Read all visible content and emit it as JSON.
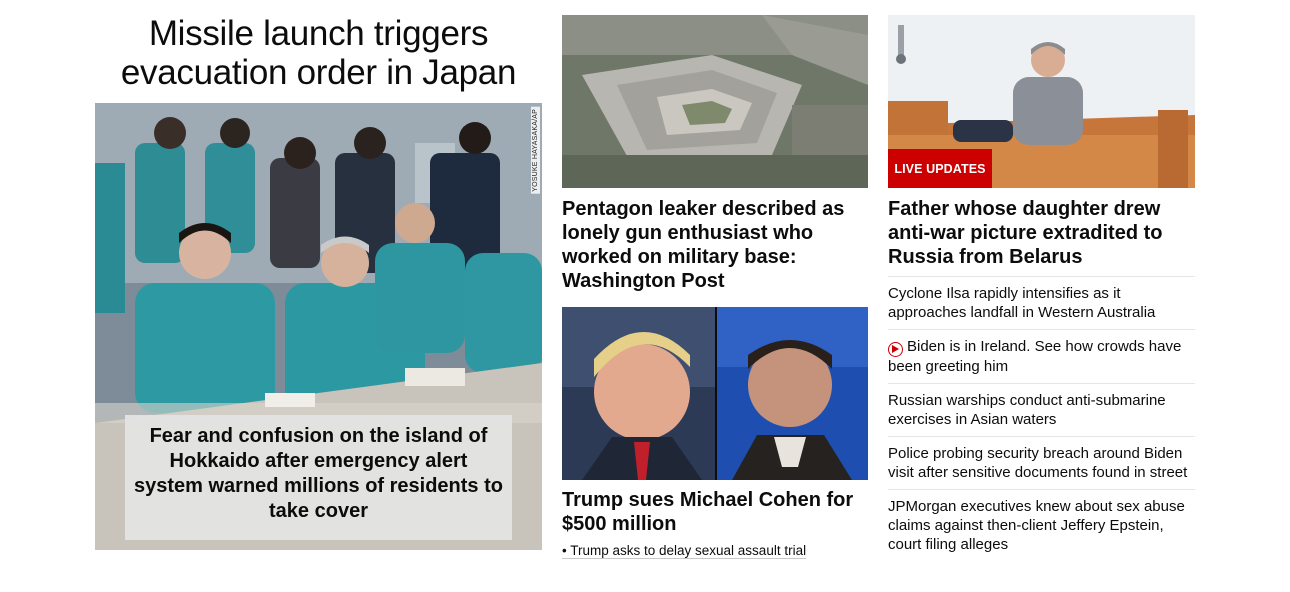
{
  "lead": {
    "headline": "Missile launch triggers evacuation order in Japan",
    "photo_credit": "YOSUKE HAYASAKA/AP",
    "caption": "Fear and confusion on the island of Hokkaido after emergency alert system warned millions of residents to take cover"
  },
  "middle": {
    "story1": {
      "headline": "Pentagon leaker described as lonely gun enthusiast who worked on military base: Washington Post"
    },
    "story2": {
      "headline": "Trump sues Michael Cohen for $500 million",
      "related_link": "• Trump asks to delay sexual assault trial"
    }
  },
  "right": {
    "badge": "LIVE UPDATES",
    "headline": "Father whose daughter drew anti-war picture extradited to Russia from Belarus",
    "list": [
      {
        "text": "Cyclone Ilsa rapidly intensifies as it approaches landfall in Western Australia",
        "video": false
      },
      {
        "text": "Biden is in Ireland. See how crowds have been greeting him",
        "video": true,
        "icon": "play-icon"
      },
      {
        "text": "Russian warships conduct anti-submarine exercises in Asian waters",
        "video": false
      },
      {
        "text": "Police probing security breach around Biden visit after sensitive documents found in street",
        "video": false
      },
      {
        "text": "JPMorgan executives knew about sex abuse claims against then-client Jeffery Epstein, court filing alleges",
        "video": false
      }
    ]
  },
  "colors": {
    "live_badge": "#cc0000",
    "divider": "#e6e6e6",
    "text": "#0c0c0c"
  }
}
